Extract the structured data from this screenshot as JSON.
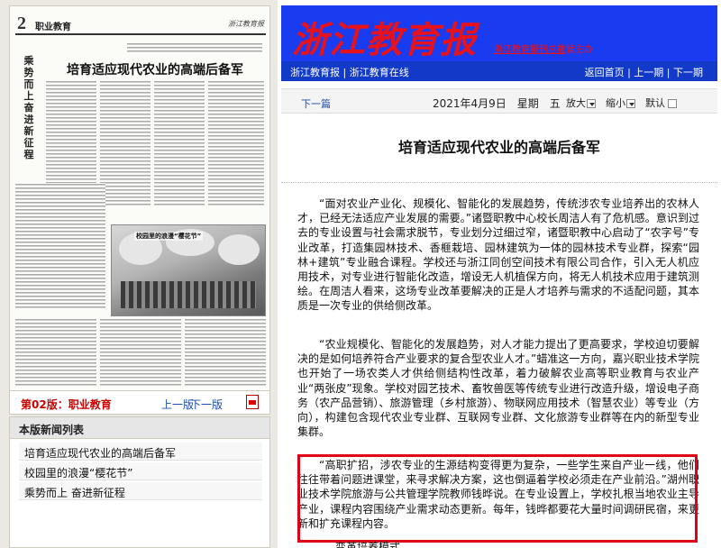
{
  "left": {
    "thumbnail": {
      "page_number": "2",
      "section": "职业教育",
      "brand": "浙江教育报",
      "headline": "培育适应现代农业的高端后备军",
      "vertical_headline": "乘势而上　奋进新征程",
      "caption": "校园里的浪漫“樱花节”"
    },
    "page_label": "第02版：职业教育",
    "prev_label": "上一版",
    "next_label": "下一版",
    "news_list_title": "本版新闻列表",
    "news_items": [
      "培育适应现代农业的高端后备军",
      "校园里的浪漫“樱花节”",
      "乘势而上 奋进新征程"
    ]
  },
  "header": {
    "logo": "浙江教育报",
    "sponsor": "浙江教育报刊总社",
    "sponsor_role": "主管主办"
  },
  "topnav": {
    "left_links": [
      "浙江教育报",
      "浙江教育在线"
    ],
    "right_links": [
      "返回首页",
      "上一期",
      "下一期"
    ]
  },
  "toolbar": {
    "next_article": "下一篇",
    "date": "2021年4月9日　星期　五",
    "zoom_in": "放大",
    "zoom_out": "缩小",
    "default": "默认"
  },
  "article": {
    "title": "培育适应现代农业的高端后备军",
    "paragraphs": [
      "“面对农业产业化、规模化、智能化的发展趋势，传统涉农专业培养出的农林人才，已经无法适应产业发展的需要。”诸暨职教中心校长周洁人有了危机感。意识到过去的专业设置与社会需求脱节，专业划分过细过窄，诸暨职教中心启动了“农字号”专业改革，打造集园林技术、香榧栽培、园林建筑为一体的园林技术专业群，探索“园林+建筑”专业融合课程。学校还与浙江同创空间技术有限公司合作，引入无人机应用技术，对专业进行智能化改造，增设无人机植保方向，将无人机技术应用于建筑测绘。在周洁人看来，这场专业改革要解决的正是人才培养与需求的不适配问题，其本质是一次专业的供给侧改革。",
      "“农业规模化、智能化的发展趋势，对人才能力提出了更高要求，学校迫切要解决的是如何培养符合产业要求的复合型农业人才。”蜡准这一方向，嘉兴职业技术学院也开始了一场农类人才供给侧结构性改革，着力破解农业高等职业教育与农业产业“两张皮”现象。学校对园艺技术、畜牧兽医等传统专业进行改造升级，增设电子商务（农产品营销）、旅游管理（乡村旅游）、物联网应用技术（智慧农业）等专业（方向），构建包含现代农业专业群、互联网专业群、文化旅游专业群等在内的新型专业集群。",
      "“高职扩招，涉农专业的生源结构变得更为复杂，一些学生来自产业一线，他们往往带着问题进课堂，来寻求解决方案，这也倒逼着学校必须走在产业前沿。”湖州职业技术学院旅游与公共管理学院教师钱晔说。在专业设置上，学校扎根当地农业主导产业，课程内容围绕产业需求动态更新。每年，钱晔都要花大量时间调研民宿，来更新和扩充课程内容。"
    ],
    "tail": "变革培养模式"
  },
  "colors": {
    "banner_blue": "#1a3cf0",
    "nav_blue": "#123ac8",
    "logo_red": "#e8121c",
    "highlight_red": "#e00018",
    "link_blue": "#1a4fb0"
  }
}
